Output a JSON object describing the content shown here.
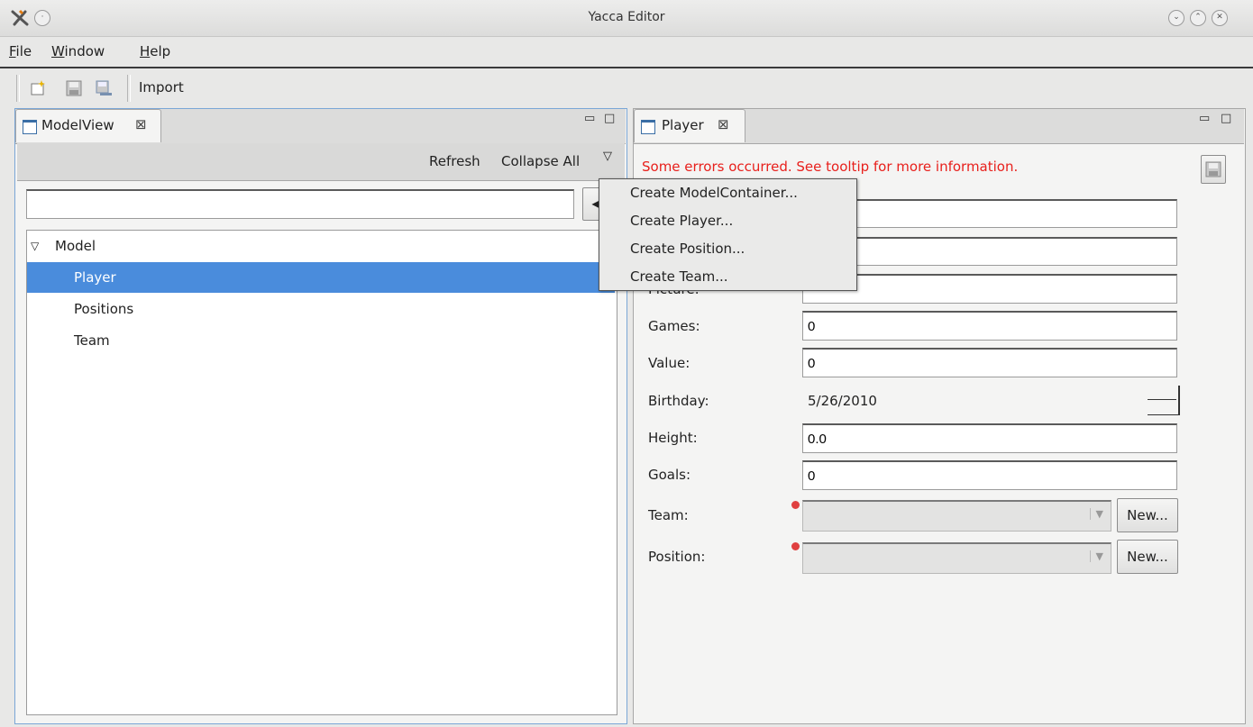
{
  "window": {
    "title": "Yacca Editor"
  },
  "menubar": {
    "items": [
      {
        "label": "File",
        "mnemonic": "F",
        "rest": "ile"
      },
      {
        "label": "Window",
        "mnemonic": "W",
        "rest": "indow"
      },
      {
        "label": "Help",
        "mnemonic": "H",
        "rest": "elp"
      }
    ]
  },
  "toolbar": {
    "import_label": "Import"
  },
  "model_view": {
    "tab_label": "ModelView",
    "refresh_label": "Refresh",
    "collapse_all_label": "Collapse All",
    "filter_value": "",
    "tree": {
      "root": "Model",
      "children": [
        "Player",
        "Positions",
        "Team"
      ],
      "selected": "Player"
    }
  },
  "context_menu": {
    "items": [
      "Create ModelContainer...",
      "Create Player...",
      "Create Position...",
      "Create Team..."
    ]
  },
  "editor": {
    "tab_label": "Player",
    "error_message": "Some errors occurred. See tooltip for more information.",
    "error_color": "#e8201c",
    "fields": {
      "picture_label_partial": "Picture:",
      "games": {
        "label": "Games:",
        "value": "0"
      },
      "value": {
        "label": "Value:",
        "value": "0"
      },
      "birthday": {
        "label": "Birthday:",
        "value": "5/26/2010"
      },
      "height": {
        "label": "Height:",
        "value": "0.0"
      },
      "goals": {
        "label": "Goals:",
        "value": "0"
      },
      "team": {
        "label": "Team:",
        "value": "",
        "new_label": "New..."
      },
      "position": {
        "label": "Position:",
        "value": "",
        "new_label": "New..."
      }
    }
  },
  "colors": {
    "selection": "#4a8cdc",
    "focus_border": "#7aa6d6"
  }
}
